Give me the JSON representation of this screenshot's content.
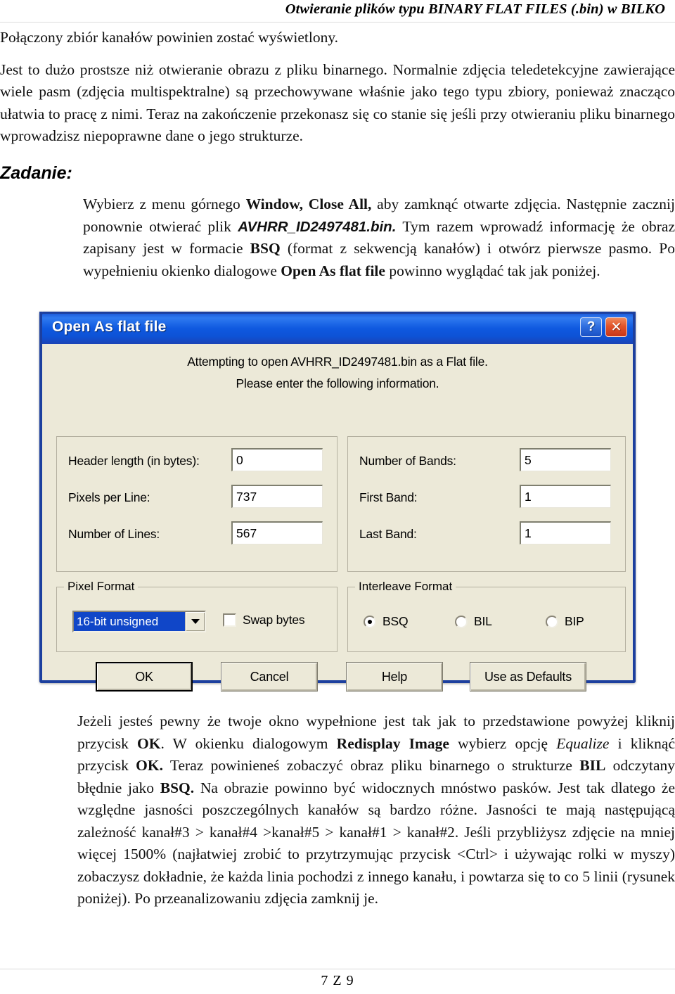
{
  "header": {
    "running_title": "Otwieranie plików typu BINARY FLAT FILES (.bin) w BILKO"
  },
  "body": {
    "intro_line": "Połączony zbiór kanałów powinien zostać wyświetlony.",
    "paragraph_1": "Jest to dużo prostsze niż otwieranie obrazu z pliku binarnego. Normalnie zdjęcia teledetekcyjne zawierające wiele pasm (zdjęcia multispektralne) są przechowywane właśnie jako tego typu zbiory, ponieważ znacząco ułatwia to pracę z nimi. Teraz na zakończenie przekonasz się co stanie się jeśli przy otwieraniu pliku binarnego wprowadzisz niepoprawne dane o jego strukturze.",
    "task_heading": "Zadanie:",
    "task_p1": "Wybierz z menu górnego ",
    "task_bold1": "Window, Close All,",
    "task_p2": " aby zamknąć otwarte zdjęcia. Następnie zacznij ponownie otwierać plik ",
    "task_file": "AVHRR_ID2497481.bin.",
    "task_p3": " Tym razem wprowadź informację że obraz zapisany jest w formacie ",
    "task_bold2": "BSQ",
    "task_p4": " (format z sekwencją kanałów) i otwórz pierwsze pasmo. Po wypełnieniu okienko dialogowe ",
    "task_bold3": "Open As flat file",
    "task_p5": " powinno wyglądać tak jak poniżej.",
    "after_p1": "Jeżeli jesteś pewny że twoje okno wypełnione jest tak jak to przedstawione powyżej kliknij przycisk ",
    "after_bold1": "OK",
    "after_p2": ". W okienku dialogowym ",
    "after_bold2": "Redisplay Image",
    "after_p3": " wybierz opcję ",
    "after_italic1": "Equalize",
    "after_p4": " i kliknąć przycisk ",
    "after_bold3": "OK.",
    "after_p5": " Teraz powinieneś zobaczyć obraz pliku binarnego o strukturze ",
    "after_bold4": "BIL",
    "after_p6": " odczytany błędnie jako ",
    "after_bold5": "BSQ.",
    "after_p7": " Na obrazie powinno być widocznych mnóstwo pasków. Jest tak dlatego że względne jasności poszczególnych kanałów są bardzo różne. Jasności te mają następującą zależność kanał#3 > kanał#4 >kanał#5 > kanał#1 > kanał#2. Jeśli przybliżysz zdjęcie na mniej więcej 1500% (najłatwiej zrobić to przytrzymując przycisk <Ctrl> i używając rolki w myszy) zobaczysz dokładnie, że każda linia pochodzi z innego kanału, i powtarza się to co 5 linii (rysunek poniżej). Po przeanalizowaniu zdjęcia zamknij je."
  },
  "dialog": {
    "title": "Open As flat file",
    "help_button": "?",
    "close_button": "✕",
    "message_line1": "Attempting to open AVHRR_ID2497481.bin as a Flat file.",
    "message_line2": "Please enter the following information.",
    "fields": {
      "header_length_label": "Header length (in bytes):",
      "header_length_value": "0",
      "pixels_per_line_label": "Pixels per Line:",
      "pixels_per_line_value": "737",
      "number_of_lines_label": "Number of Lines:",
      "number_of_lines_value": "567",
      "number_of_bands_label": "Number of Bands:",
      "number_of_bands_value": "5",
      "first_band_label": "First Band:",
      "first_band_value": "1",
      "last_band_label": "Last Band:",
      "last_band_value": "1"
    },
    "pixel_format": {
      "group_title": "Pixel Format",
      "selected_value": "16-bit unsigned",
      "swap_bytes_label": "Swap bytes",
      "swap_bytes_checked": false
    },
    "interleave_format": {
      "group_title": "Interleave Format",
      "options": [
        {
          "label": "BSQ",
          "selected": true
        },
        {
          "label": "BIL",
          "selected": false
        },
        {
          "label": "BIP",
          "selected": false
        }
      ]
    },
    "buttons": {
      "ok": "OK",
      "cancel": "Cancel",
      "help": "Help",
      "use_as_defaults": "Use as Defaults"
    },
    "colors": {
      "titlebar_blue": "#1046c8",
      "dialog_face": "#ece9d8",
      "selection_blue": "#1046c8",
      "close_red": "#e1542a"
    }
  },
  "footer": {
    "page_label": "7 Z 9"
  }
}
